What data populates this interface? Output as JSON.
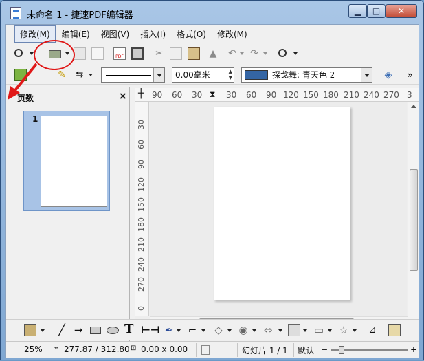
{
  "window": {
    "title": "未命名 1 - 捷速PDF编辑器"
  },
  "menu": [
    "修改(M)",
    "编辑(E)",
    "视图(V)",
    "插入(I)",
    "格式(O)",
    "修改(M)"
  ],
  "toolbar2": {
    "line_width": "0.00毫米",
    "fill_color_name": "探戈舞: 青天色 2",
    "fill_color": "#3465a4"
  },
  "pages_panel": {
    "title": "页数",
    "close": "×",
    "thumb_number": "1"
  },
  "ruler": {
    "horizontal": [
      "90",
      "60",
      "30",
      "30",
      "60",
      "90",
      "120",
      "150",
      "180",
      "210",
      "240",
      "270",
      "3"
    ],
    "vertical": [
      "30",
      "60",
      "90",
      "120",
      "150",
      "180",
      "210",
      "240",
      "270",
      "0"
    ]
  },
  "statusbar": {
    "zoom": "25%",
    "position": "277.87 / 312.80",
    "size": "0.00 x 0.00",
    "slide": "幻灯片 1 / 1",
    "layout": "默认"
  },
  "annotation": {
    "color": "#e01818"
  }
}
